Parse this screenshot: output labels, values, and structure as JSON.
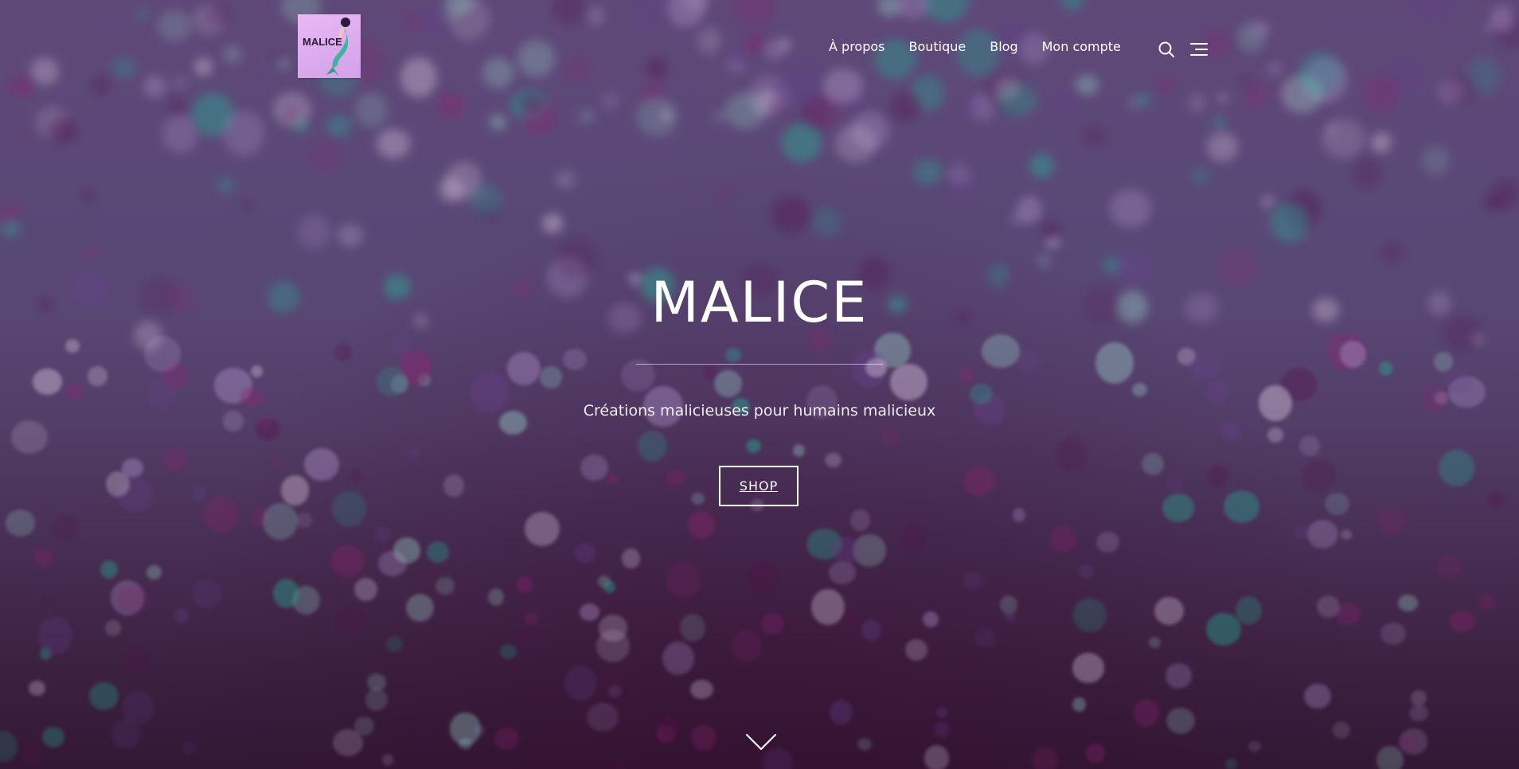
{
  "logo": {
    "text": "MALICE"
  },
  "nav": {
    "items": [
      {
        "label": "À propos"
      },
      {
        "label": "Boutique"
      },
      {
        "label": "Blog"
      },
      {
        "label": "Mon compte"
      }
    ]
  },
  "icons": {
    "search": "search-icon",
    "menu": "menu-icon",
    "scroll": "chevron-down-icon"
  },
  "hero": {
    "title": "MALICE",
    "tagline": "Créations malicieuses pour humains malicieux",
    "button_label": "SHOP"
  },
  "colors": {
    "hero_top": "#6b5486",
    "hero_bottom": "#3a1c3c",
    "logo_bg": "#d5a0ea",
    "text": "#ffffff"
  }
}
